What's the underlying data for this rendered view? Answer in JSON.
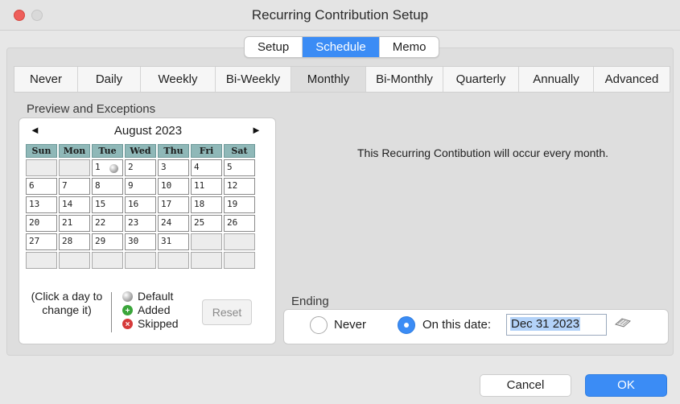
{
  "window": {
    "title": "Recurring Contribution Setup"
  },
  "segments": [
    "Setup",
    "Schedule",
    "Memo"
  ],
  "active_segment": "Schedule",
  "tabs": [
    "Never",
    "Daily",
    "Weekly",
    "Bi-Weekly",
    "Monthly",
    "Bi-Monthly",
    "Quarterly",
    "Annually",
    "Advanced"
  ],
  "selected_tab": "Monthly",
  "preview": {
    "label": "Preview and Exceptions",
    "prev_icon": "◄",
    "next_icon": "►",
    "month": "August 2023",
    "weekdays": [
      "Sun",
      "Mon",
      "Tue",
      "Wed",
      "Thu",
      "Fri",
      "Sat"
    ],
    "weeks": [
      [
        "",
        "",
        "1",
        "2",
        "3",
        "4",
        "5"
      ],
      [
        "6",
        "7",
        "8",
        "9",
        "10",
        "11",
        "12"
      ],
      [
        "13",
        "14",
        "15",
        "16",
        "17",
        "18",
        "19"
      ],
      [
        "20",
        "21",
        "22",
        "23",
        "24",
        "25",
        "26"
      ],
      [
        "27",
        "28",
        "29",
        "30",
        "31",
        "",
        ""
      ],
      [
        "",
        "",
        "",
        "",
        "",
        "",
        ""
      ]
    ],
    "default_marked_day": "1",
    "help_text": "(Click a day to change it)",
    "legend": {
      "default": "Default",
      "added": "Added",
      "skipped": "Skipped"
    },
    "reset_label": "Reset"
  },
  "message": "This Recurring Contibution will occur every month.",
  "ending": {
    "label": "Ending",
    "never_label": "Never",
    "on_date_label": "On this date:",
    "date_value": "Dec 31 2023",
    "selected": "on_date"
  },
  "buttons": {
    "cancel": "Cancel",
    "ok": "OK"
  },
  "colors": {
    "accent": "#3b8cf5",
    "calendar_header": "#8fb8b8",
    "close": "#ee5e5a"
  }
}
